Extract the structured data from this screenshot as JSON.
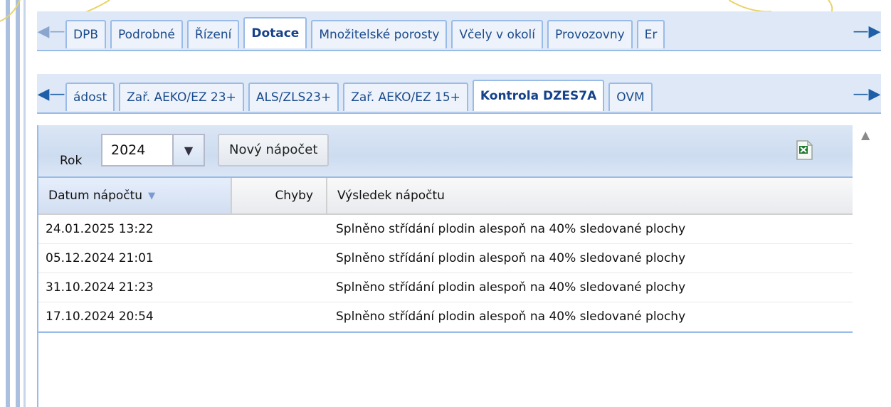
{
  "top_tabs": {
    "items": [
      {
        "label": "DPB",
        "active": false
      },
      {
        "label": "Podrobné",
        "active": false
      },
      {
        "label": "Řízení",
        "active": false
      },
      {
        "label": "Dotace",
        "active": true
      },
      {
        "label": "Množitelské porosty",
        "active": false
      },
      {
        "label": "Včely v okolí",
        "active": false
      },
      {
        "label": "Provozovny",
        "active": false
      },
      {
        "label": "Er",
        "active": false
      }
    ]
  },
  "sub_tabs": {
    "items": [
      {
        "label": "ádost",
        "active": false
      },
      {
        "label": "Zař. AEKO/EZ 23+",
        "active": false
      },
      {
        "label": "ALS/ZLS23+",
        "active": false
      },
      {
        "label": "Zař. AEKO/EZ 15+",
        "active": false
      },
      {
        "label": "Kontrola DZES7A",
        "active": true
      },
      {
        "label": "OVM",
        "active": false
      }
    ]
  },
  "toolbar": {
    "year_label": "Rok",
    "year_value": "2024",
    "new_button_label": "Nový nápočet"
  },
  "grid": {
    "headers": [
      "Datum nápočtu",
      "Chyby",
      "Výsledek nápočtu"
    ],
    "rows": [
      {
        "date": "24.01.2025 13:22",
        "errors": "",
        "result": "Splněno střídání plodin alespoň na 40% sledované plochy"
      },
      {
        "date": "05.12.2024 21:01",
        "errors": "",
        "result": "Splněno střídání plodin alespoň na 40% sledované plochy"
      },
      {
        "date": "31.10.2024 21:23",
        "errors": "",
        "result": "Splněno střídání plodin alespoň na 40% sledované plochy"
      },
      {
        "date": "17.10.2024 20:54",
        "errors": "",
        "result": "Splněno střídání plodin alespoň na 40% sledované plochy"
      }
    ]
  },
  "colors": {
    "accent": "#15428b",
    "border": "#99bbe8",
    "excel": "#1e7a2f"
  }
}
